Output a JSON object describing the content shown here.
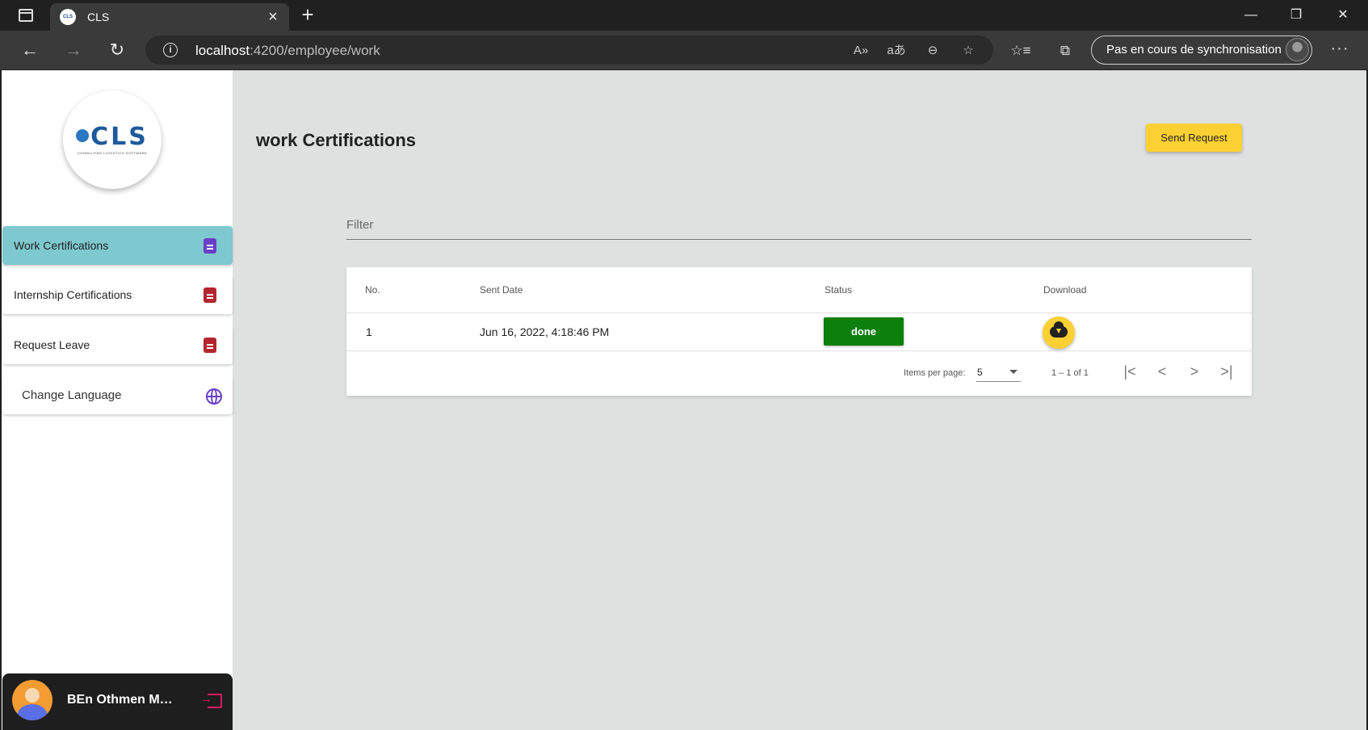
{
  "browser": {
    "tab_title": "CLS",
    "tab_favicon_text": "CLS",
    "url_host": "localhost",
    "url_path": ":4200/employee/work",
    "sync_label": "Pas en cours de synchronisation",
    "icons": {
      "back": "←",
      "forward": "→",
      "reload": "↻",
      "read_aloud": "A»",
      "translate": "aあ",
      "zoom_out": "⊖",
      "favorite_add": "☆",
      "favorites": "☆≡",
      "collections": "⧉",
      "more": "···",
      "minimize": "—",
      "restore": "❐",
      "close": "✕",
      "tab_close": "×",
      "new_tab": "+"
    }
  },
  "sidebar": {
    "logo_text": "CLS",
    "logo_subtext": "CONSULTING LOGISTICS SOFTWARE",
    "items": [
      {
        "label": "Work Certifications"
      },
      {
        "label": "Internship Certifications"
      },
      {
        "label": "Request Leave"
      },
      {
        "label": "Change Language"
      }
    ],
    "user_name": "BEn Othmen Mohamed"
  },
  "main": {
    "title": "work Certifications",
    "send_request_label": "Send Request",
    "filter_placeholder": "Filter",
    "table": {
      "columns": [
        "No.",
        "Sent Date",
        "Status",
        "Download"
      ],
      "rows": [
        {
          "no": "1",
          "sent_date": "Jun 16, 2022, 4:18:46 PM",
          "status": "done"
        }
      ]
    },
    "paginator": {
      "items_per_page_label": "Items per page:",
      "page_size": "5",
      "range_label": "1 – 1 of 1",
      "first": "|<",
      "prev": "<",
      "next": ">",
      "last": ">|"
    }
  },
  "colors": {
    "active_nav": "#7ec8cf",
    "accent_yellow": "#fcd033",
    "status_done": "#0d7f0d",
    "doc_icon_red": "#b3262e",
    "doc_icon_purple": "#6a3fc8"
  }
}
